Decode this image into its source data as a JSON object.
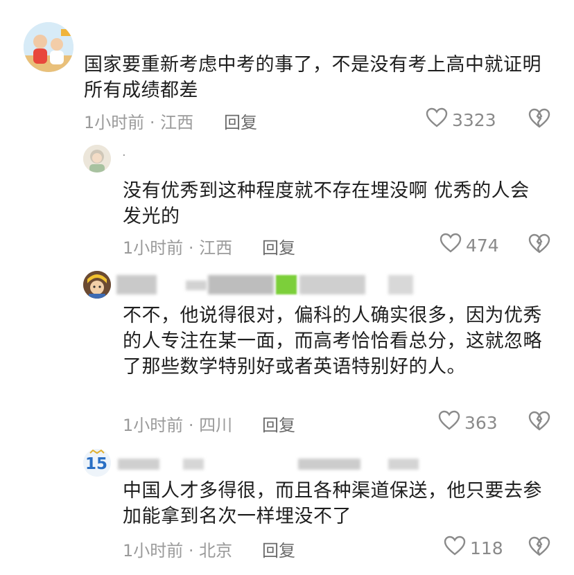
{
  "comments": [
    {
      "text": "国家要重新考虑中考的事了，不是没有考上高中就证明所有成绩都差",
      "meta": "1小时前 · 江西",
      "reply_label": "回复",
      "likes": "3323"
    },
    {
      "username": "·",
      "text": "没有优秀到这种程度就不存在埋没啊  优秀的人会发光的",
      "meta": "1小时前 · 江西",
      "reply_label": "回复",
      "likes": "474"
    },
    {
      "text": "不不，他说得很对，偏科的人确实很多，因为优秀的人专注在某一面，而高考恰恰看总分，这就忽略了那些数学特别好或者英语特别好的人。",
      "meta": "1小时前 · 四川",
      "reply_label": "回复",
      "likes": "363"
    },
    {
      "avatar_text": "15",
      "text": "中国人才多得很，而且各种渠道保送，他只要去参加能拿到名次一样埋没不了",
      "meta": "1小时前 · 北京",
      "reply_label": "回复",
      "likes": "118"
    }
  ],
  "icons": {
    "like": "heart-outline-icon",
    "dislike": "broken-heart-icon"
  },
  "colors": {
    "meta_text": "#9a9a9a",
    "reply_text": "#6a6a6a",
    "redaction_green": "#7ccf3a"
  }
}
